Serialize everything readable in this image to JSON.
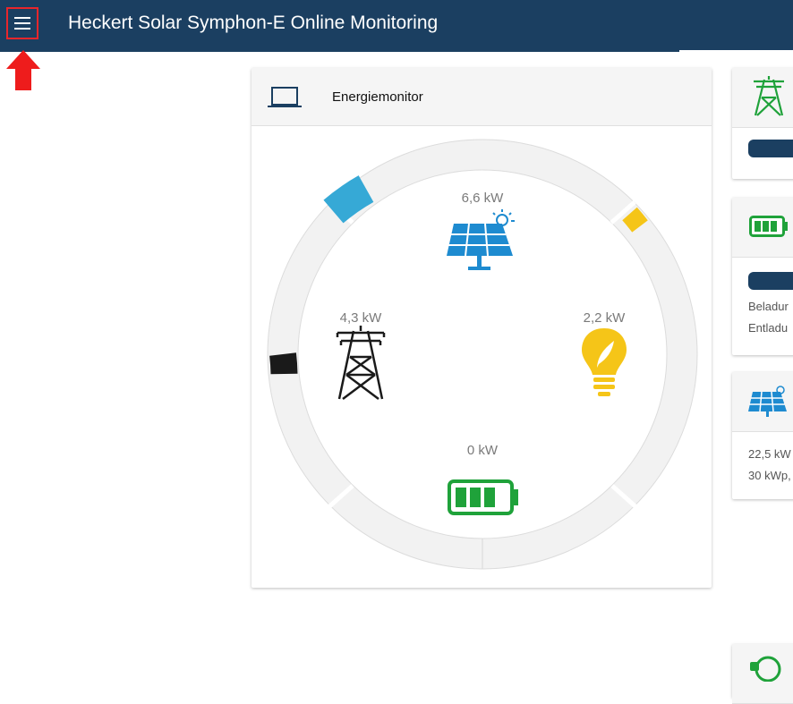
{
  "header": {
    "title": "Heckert Solar Symphon-E Online Monitoring",
    "menu_icon": "hamburger-menu-icon"
  },
  "colors": {
    "header_bg": "#1b3f61",
    "solar": "#1e8bd0",
    "grid": "#1a1a1a",
    "consumption": "#f5c518",
    "battery": "#1fa23a",
    "ring_solar_segment": "#36a9d6",
    "ring_consumption_segment": "#f5c518",
    "ring_grid_segment": "#1a1a1a"
  },
  "energy_monitor": {
    "title": "Energiemonitor",
    "solar_value": "6,6 kW",
    "grid_value": "4,3 kW",
    "consumption_value": "2,2 kW",
    "battery_value": "0 kW"
  },
  "side_cards": {
    "battery_line1": "Beladur",
    "battery_line2": "Entladu",
    "pv_line1": "22,5 kW",
    "pv_line2": "30 kWp,"
  }
}
